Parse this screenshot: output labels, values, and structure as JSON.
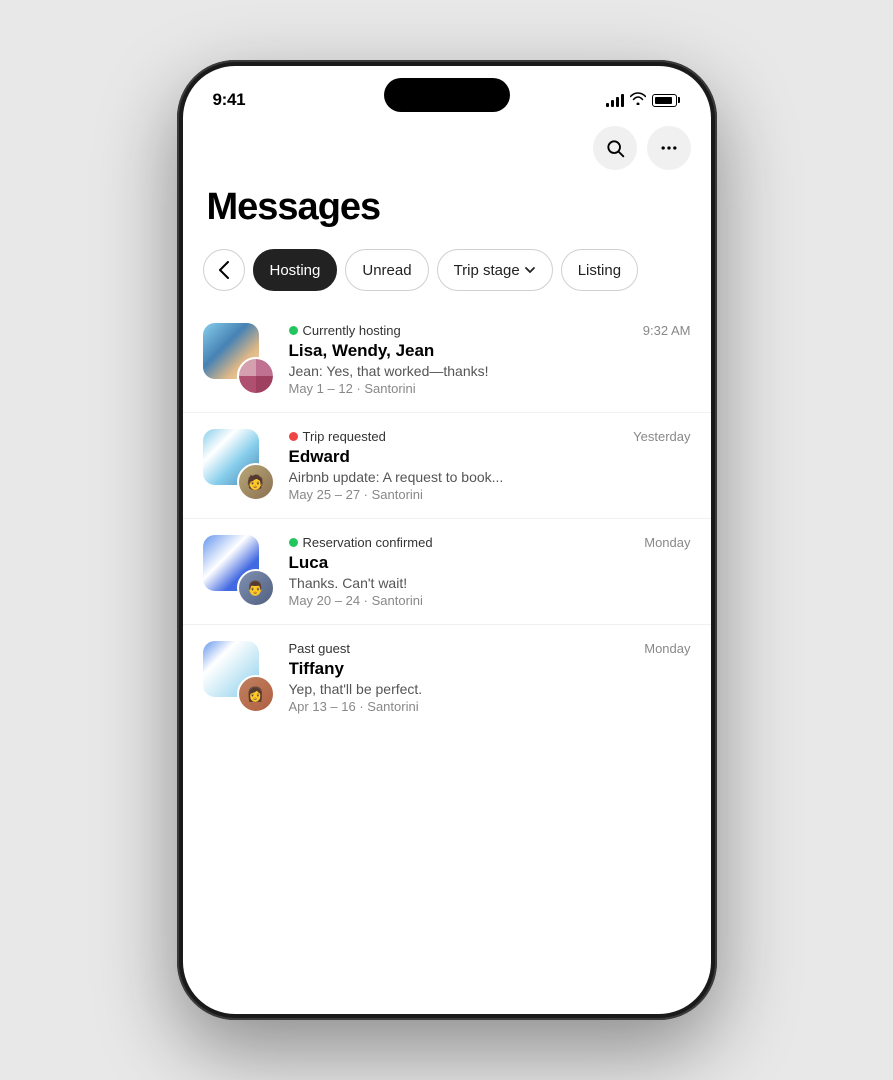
{
  "phone": {
    "time": "9:41",
    "dynamic_island": true
  },
  "header": {
    "title": "Messages",
    "search_label": "Search",
    "more_label": "More options"
  },
  "filters": {
    "back_label": "←",
    "items": [
      {
        "id": "hosting",
        "label": "Hosting",
        "active": true
      },
      {
        "id": "unread",
        "label": "Unread",
        "active": false
      },
      {
        "id": "trip-stage",
        "label": "Trip stage",
        "active": false,
        "has_chevron": true
      },
      {
        "id": "listing",
        "label": "Listing",
        "active": false
      }
    ]
  },
  "messages": [
    {
      "id": 1,
      "status_dot": "green",
      "status_label": "Currently hosting",
      "time": "9:32 AM",
      "sender": "Lisa, Wendy, Jean",
      "preview": "Jean: Yes, that worked—thanks!",
      "meta": "May 1 – 12 · Santorini",
      "is_group": true
    },
    {
      "id": 2,
      "status_dot": "red",
      "status_label": "Trip requested",
      "time": "Yesterday",
      "sender": "Edward",
      "preview": "Airbnb update: A request to book...",
      "meta": "May 25 – 27 · Santorini",
      "is_group": false
    },
    {
      "id": 3,
      "status_dot": "green",
      "status_label": "Reservation confirmed",
      "time": "Monday",
      "sender": "Luca",
      "preview": "Thanks. Can't wait!",
      "meta": "May 20 – 24 · Santorini",
      "is_group": false
    },
    {
      "id": 4,
      "status_dot": "none",
      "status_label": "Past guest",
      "time": "Monday",
      "sender": "Tiffany",
      "preview": "Yep, that'll be perfect.",
      "meta": "Apr 13 – 16 · Santorini",
      "is_group": false
    }
  ]
}
